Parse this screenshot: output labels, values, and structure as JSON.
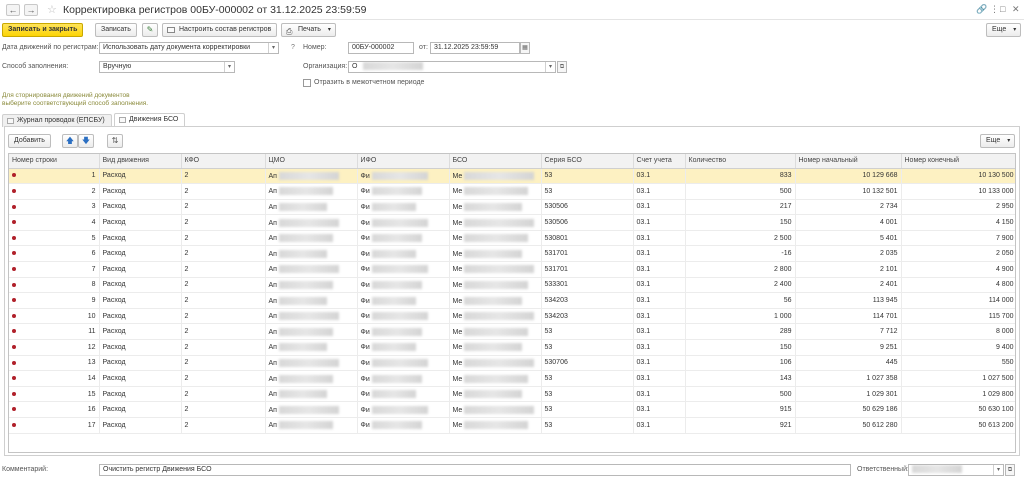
{
  "window": {
    "title": "Корректировка регистров 00БУ-000002 от 31.12.2025 23:59:59"
  },
  "toolbar": {
    "save_close": "Записать и закрыть",
    "save": "Записать",
    "configure": "Настроить состав регистров",
    "print": "Печать",
    "more": "Еще"
  },
  "form": {
    "date_label": "Дата движений по регистрам:",
    "date_value": "Использовать дату документа корректировки",
    "help": "?",
    "number_label": "Номер:",
    "number_value": "00БУ-000002",
    "from_label": "от:",
    "from_value": "31.12.2025 23:59:59",
    "fill_label": "Способ заполнения:",
    "fill_value": "Вручную",
    "org_label": "Организация:",
    "org_value": "О",
    "interperiod_label": "Отразить в межотчетном периоде",
    "hint": "Для сторнирования движений документов выберите соответствующий способ заполнения."
  },
  "tabs": [
    {
      "label": "Журнал проводок (ЕПСБУ)"
    },
    {
      "label": "Движения БСО"
    }
  ],
  "table_toolbar": {
    "add": "Добавить",
    "more": "Еще"
  },
  "table": {
    "headers": [
      "Номер строки",
      "Вид движения",
      "КФО",
      "ЦМО",
      "ИФО",
      "БСО",
      "Серия БСО",
      "Счет учета",
      "Количество",
      "Номер начальный",
      "Номер конечный"
    ],
    "rows": [
      {
        "n": "1",
        "kind": "Расход",
        "kfo": "2",
        "cmo": "Ап",
        "ifo": "Фи",
        "bso": "Ме",
        "series": "53",
        "acc": "03.1",
        "qty": "833",
        "start": "10 129 668",
        "end": "10 130 500"
      },
      {
        "n": "2",
        "kind": "Расход",
        "kfo": "2",
        "cmo": "Ап",
        "ifo": "Фи",
        "bso": "Ме",
        "series": "53",
        "acc": "03.1",
        "qty": "500",
        "start": "10 132 501",
        "end": "10 133 000"
      },
      {
        "n": "3",
        "kind": "Расход",
        "kfo": "2",
        "cmo": "Ап",
        "ifo": "Фи",
        "bso": "Ме",
        "series": "530506",
        "acc": "03.1",
        "qty": "217",
        "start": "2 734",
        "end": "2 950"
      },
      {
        "n": "4",
        "kind": "Расход",
        "kfo": "2",
        "cmo": "Ап",
        "ifo": "Фи",
        "bso": "Ме",
        "series": "530506",
        "acc": "03.1",
        "qty": "150",
        "start": "4 001",
        "end": "4 150"
      },
      {
        "n": "5",
        "kind": "Расход",
        "kfo": "2",
        "cmo": "Ап",
        "ifo": "Фи",
        "bso": "Ме",
        "series": "530801",
        "acc": "03.1",
        "qty": "2 500",
        "start": "5 401",
        "end": "7 900"
      },
      {
        "n": "6",
        "kind": "Расход",
        "kfo": "2",
        "cmo": "Ап",
        "ifo": "Фи",
        "bso": "Ме",
        "series": "531701",
        "acc": "03.1",
        "qty": "-16",
        "start": "2 035",
        "end": "2 050"
      },
      {
        "n": "7",
        "kind": "Расход",
        "kfo": "2",
        "cmo": "Ап",
        "ifo": "Фи",
        "bso": "Ме",
        "series": "531701",
        "acc": "03.1",
        "qty": "2 800",
        "start": "2 101",
        "end": "4 900"
      },
      {
        "n": "8",
        "kind": "Расход",
        "kfo": "2",
        "cmo": "Ап",
        "ifo": "Фи",
        "bso": "Ме",
        "series": "533301",
        "acc": "03.1",
        "qty": "2 400",
        "start": "2 401",
        "end": "4 800"
      },
      {
        "n": "9",
        "kind": "Расход",
        "kfo": "2",
        "cmo": "Ап",
        "ifo": "Фи",
        "bso": "Ме",
        "series": "534203",
        "acc": "03.1",
        "qty": "56",
        "start": "113 945",
        "end": "114 000"
      },
      {
        "n": "10",
        "kind": "Расход",
        "kfo": "2",
        "cmo": "Ап",
        "ifo": "Фи",
        "bso": "Ме",
        "series": "534203",
        "acc": "03.1",
        "qty": "1 000",
        "start": "114 701",
        "end": "115 700"
      },
      {
        "n": "11",
        "kind": "Расход",
        "kfo": "2",
        "cmo": "Ап",
        "ifo": "Фи",
        "bso": "Ме",
        "series": "53",
        "acc": "03.1",
        "qty": "289",
        "start": "7 712",
        "end": "8 000"
      },
      {
        "n": "12",
        "kind": "Расход",
        "kfo": "2",
        "cmo": "Ап",
        "ifo": "Фи",
        "bso": "Ме",
        "series": "53",
        "acc": "03.1",
        "qty": "150",
        "start": "9 251",
        "end": "9 400"
      },
      {
        "n": "13",
        "kind": "Расход",
        "kfo": "2",
        "cmo": "Ап",
        "ifo": "Фи",
        "bso": "Ме",
        "series": "530706",
        "acc": "03.1",
        "qty": "106",
        "start": "445",
        "end": "550"
      },
      {
        "n": "14",
        "kind": "Расход",
        "kfo": "2",
        "cmo": "Ап",
        "ifo": "Фи",
        "bso": "Ме",
        "series": "53",
        "acc": "03.1",
        "qty": "143",
        "start": "1 027 358",
        "end": "1 027 500"
      },
      {
        "n": "15",
        "kind": "Расход",
        "kfo": "2",
        "cmo": "Ап",
        "ifo": "Фи",
        "bso": "Ме",
        "series": "53",
        "acc": "03.1",
        "qty": "500",
        "start": "1 029 301",
        "end": "1 029 800"
      },
      {
        "n": "16",
        "kind": "Расход",
        "kfo": "2",
        "cmo": "Ап",
        "ifo": "Фи",
        "bso": "Ме",
        "series": "53",
        "acc": "03.1",
        "qty": "915",
        "start": "50 629 186",
        "end": "50 630 100"
      },
      {
        "n": "17",
        "kind": "Расход",
        "kfo": "2",
        "cmo": "Ап",
        "ifo": "Фи",
        "bso": "Ме",
        "series": "53",
        "acc": "03.1",
        "qty": "921",
        "start": "50 612 280",
        "end": "50 613 200"
      }
    ]
  },
  "footer": {
    "comment_label": "Комментарий:",
    "comment_value": "Очистить регистр Движения БСО",
    "responsible_label": "Ответственный:"
  },
  "icons": {
    "back": "arrow-left-icon",
    "forward": "arrow-right-icon",
    "favorite": "star-icon",
    "link": "link-icon",
    "menu": "more-vertical-icon",
    "maximize": "maximize-icon",
    "close": "close-icon"
  },
  "colors": {
    "primary_button": "#fcd405",
    "selected_row": "#fdf1c2",
    "row_marker": "#b0202a",
    "hint_text": "#8a8a3a"
  }
}
